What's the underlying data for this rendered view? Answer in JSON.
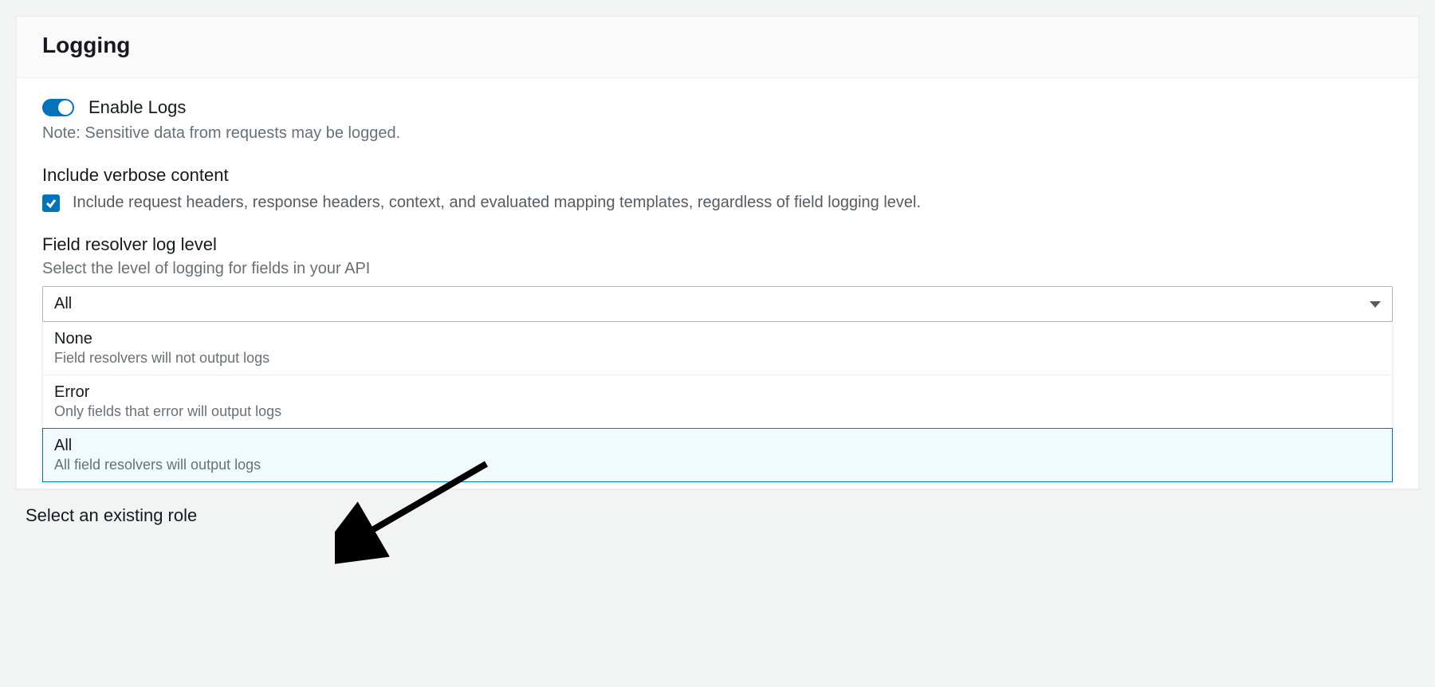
{
  "header": {
    "title": "Logging"
  },
  "enableLogs": {
    "label": "Enable Logs",
    "note": "Note: Sensitive data from requests may be logged."
  },
  "verbose": {
    "title": "Include verbose content",
    "checkbox_label": "Include request headers, response headers, context, and evaluated mapping templates, regardless of field logging level."
  },
  "logLevel": {
    "title": "Field resolver log level",
    "desc": "Select the level of logging for fields in your API",
    "selected": "All",
    "options": [
      {
        "title": "None",
        "desc": "Field resolvers will not output logs"
      },
      {
        "title": "Error",
        "desc": "Only fields that error will output logs"
      },
      {
        "title": "All",
        "desc": "All field resolvers will output logs"
      }
    ]
  },
  "role": {
    "title": "Select an existing role"
  }
}
